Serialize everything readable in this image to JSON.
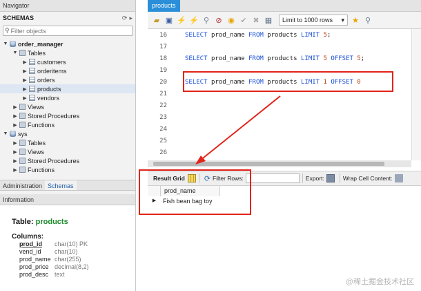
{
  "navigator": {
    "title": "Navigator",
    "schemas_title": "SCHEMAS",
    "filter_placeholder": "Filter objects",
    "tree": [
      {
        "label": "order_manager",
        "level": 0,
        "icon": "db",
        "bold": true,
        "expanded": true
      },
      {
        "label": "Tables",
        "level": 1,
        "icon": "folder",
        "expanded": true
      },
      {
        "label": "customers",
        "level": 2,
        "icon": "table"
      },
      {
        "label": "orderitems",
        "level": 2,
        "icon": "table"
      },
      {
        "label": "orders",
        "level": 2,
        "icon": "table"
      },
      {
        "label": "products",
        "level": 2,
        "icon": "table",
        "selected": true
      },
      {
        "label": "vendors",
        "level": 2,
        "icon": "table"
      },
      {
        "label": "Views",
        "level": 1,
        "icon": "folder"
      },
      {
        "label": "Stored Procedures",
        "level": 1,
        "icon": "folder"
      },
      {
        "label": "Functions",
        "level": 1,
        "icon": "folder"
      },
      {
        "label": "sys",
        "level": 0,
        "icon": "db",
        "expanded": true
      },
      {
        "label": "Tables",
        "level": 1,
        "icon": "folder"
      },
      {
        "label": "Views",
        "level": 1,
        "icon": "folder"
      },
      {
        "label": "Stored Procedures",
        "level": 1,
        "icon": "folder"
      },
      {
        "label": "Functions",
        "level": 1,
        "icon": "folder"
      }
    ],
    "bottom_tabs": [
      "Administration",
      "Schemas"
    ],
    "active_bottom_tab": "Schemas"
  },
  "information": {
    "header": "Information",
    "table_label": "Table:",
    "table_name": "products",
    "columns_label": "Columns:",
    "columns": [
      {
        "name": "prod_id",
        "type": "char(10) PK",
        "pk": true
      },
      {
        "name": "vend_id",
        "type": "char(10)"
      },
      {
        "name": "prod_name",
        "type": "char(255)"
      },
      {
        "name": "prod_price",
        "type": "decimal(8,2)"
      },
      {
        "name": "prod_desc",
        "type": "text"
      }
    ]
  },
  "editor": {
    "tab": "products",
    "limit_select": "Limit to 1000 rows",
    "lines": [
      {
        "no": "16",
        "sql": [
          [
            "kw",
            "SELECT "
          ],
          [
            "id",
            "prod_name "
          ],
          [
            "kw",
            "FROM "
          ],
          [
            "id",
            "products "
          ],
          [
            "kw",
            "LIMIT "
          ],
          [
            "num",
            "5"
          ],
          [
            "id",
            ";"
          ]
        ]
      },
      {
        "no": "17",
        "sql": []
      },
      {
        "no": "18",
        "sql": [
          [
            "kw",
            "SELECT "
          ],
          [
            "id",
            "prod_name "
          ],
          [
            "kw",
            "FROM "
          ],
          [
            "id",
            "products "
          ],
          [
            "kw",
            "LIMIT "
          ],
          [
            "num",
            "5 "
          ],
          [
            "kw",
            "OFFSET "
          ],
          [
            "num",
            "5"
          ],
          [
            "id",
            ";"
          ]
        ]
      },
      {
        "no": "19",
        "sql": []
      },
      {
        "no": "20",
        "sql": [
          [
            "kw",
            "SELECT "
          ],
          [
            "id",
            "prod_name "
          ],
          [
            "kw",
            "FROM "
          ],
          [
            "id",
            "products "
          ],
          [
            "kw",
            "LIMIT "
          ],
          [
            "num",
            "1 "
          ],
          [
            "kw",
            "OFFSET "
          ],
          [
            "num",
            "0"
          ]
        ]
      },
      {
        "no": "21",
        "sql": []
      },
      {
        "no": "22",
        "sql": []
      },
      {
        "no": "23",
        "sql": []
      },
      {
        "no": "24",
        "sql": []
      },
      {
        "no": "25",
        "sql": []
      },
      {
        "no": "26",
        "sql": []
      }
    ]
  },
  "result": {
    "grid_label": "Result Grid",
    "filter_label": "Filter Rows:",
    "export_label": "Export:",
    "wrap_label": "Wrap Cell Content:",
    "column": "prod_name",
    "rows": [
      "Fish bean bag toy"
    ]
  },
  "watermark": "@稀土掘金技术社区",
  "colors": {
    "highlight": "#e2231a",
    "keyword": "#1a4fd6",
    "number": "#c43d13",
    "tab_active": "#2a8fd8"
  }
}
